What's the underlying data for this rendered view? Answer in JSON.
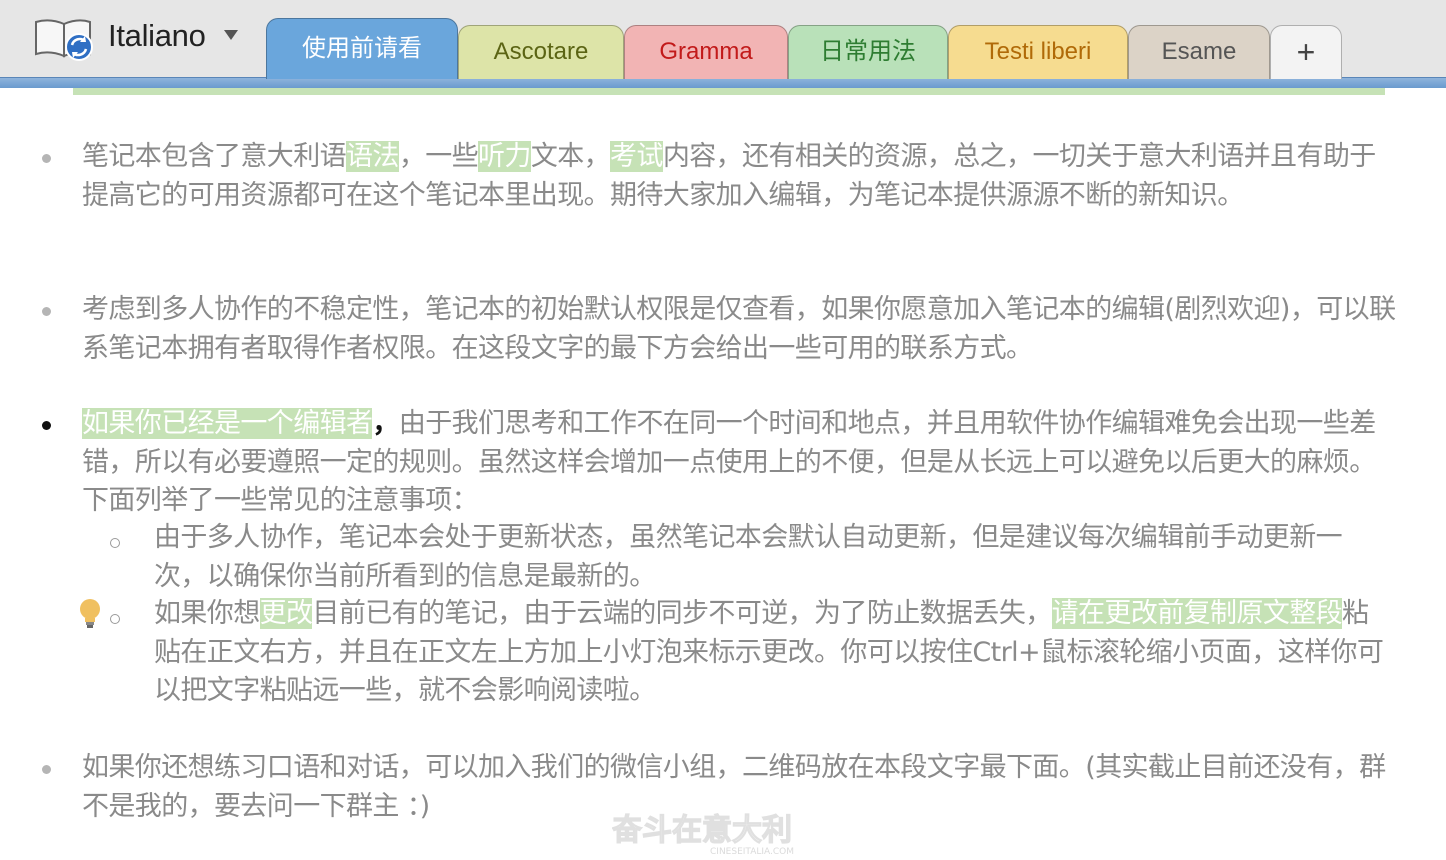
{
  "notebook": {
    "title": "Italiano",
    "icon": "notebook-sync-icon",
    "dropdown_icon": "caret-down-icon"
  },
  "tabs": [
    {
      "label": "使用前请看",
      "bg": "#6aa6dc",
      "fg": "#ffffff",
      "active": true
    },
    {
      "label": "Ascotare",
      "bg": "#dde4a8",
      "fg": "#5b6414",
      "active": false
    },
    {
      "label": "Gramma",
      "bg": "#f2b4b4",
      "fg": "#c21a1a",
      "active": false
    },
    {
      "label": "日常用法",
      "bg": "#b9e1b9",
      "fg": "#2e7d32",
      "active": false
    },
    {
      "label": "Testi liberi",
      "bg": "#f6dc90",
      "fg": "#b06a08",
      "active": false
    },
    {
      "label": "Esame",
      "bg": "#dcd3c7",
      "fg": "#555555",
      "active": false
    },
    {
      "label": "+",
      "bg": "#f3f3f3",
      "fg": "#444444",
      "active": false
    }
  ],
  "content": {
    "p1": {
      "a": "笔记本包含了意大利语",
      "hl1": "语法",
      "b": "，一些",
      "hl2": "听力",
      "c": "文本，",
      "hl3": "考试",
      "d": "内容，还有相关的资源，总之，一切关于意大利语并且有助于提高它的可用资源都可在这个笔记本里出现。期待大家加入编辑，为笔记本提供源源不断的新知识。"
    },
    "p2": "考虑到多人协作的不稳定性，笔记本的初始默认权限是仅查看，如果你愿意加入笔记本的编辑(剧烈欢迎)，可以联系笔记本拥有者取得作者权限。在这段文字的最下方会给出一些可用的联系方式。",
    "p3": {
      "hl": "如果你已经是一个编辑者",
      "comma": "，",
      "rest": "由于我们思考和工作不在同一个时间和地点，并且用软件协作编辑难免会出现一些差错，所以有必要遵照一定的规则。虽然这样会增加一点使用上的不便，但是从长远上可以避免以后更大的麻烦。下面列举了一些常见的注意事项："
    },
    "s1": "由于多人协作，笔记本会处于更新状态，虽然笔记本会默认自动更新，但是建议每次编辑前手动更新一次，以确保你当前所看到的信息是最新的。",
    "s2": {
      "a": "如果你想",
      "hl1": "更改",
      "b": "目前已有的笔记，由于云端的同步不可逆，为了防止数据丢失，",
      "hl2": "请在更改前复制原文整段",
      "c": "粘贴在正文右方，并且在正文左上方加上小灯泡来标示更改。你可以按住Ctrl+鼠标滚轮缩小页面，这样你可以把文字粘贴远一些，就不会影响阅读啦。"
    },
    "p4": "如果你还想练习口语和对话，可以加入我们的微信小组，二维码放在本段文字最下面。(其实截止目前还没有，群不是我的，要去问一下群主 ：)",
    "bulb_icon": "lightbulb-icon"
  },
  "watermark": {
    "main": "奋斗在意大利",
    "sub": "CINESEITALIA.COM"
  }
}
